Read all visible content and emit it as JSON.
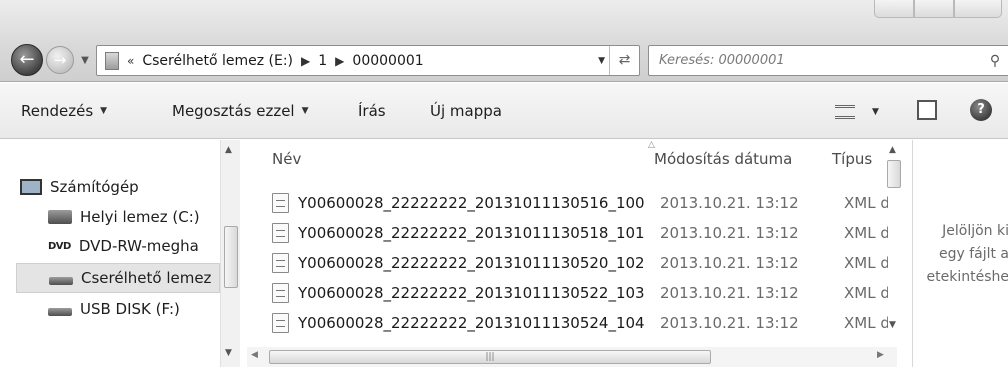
{
  "address": {
    "overflow_chevron": "«",
    "segments": [
      "Cserélhető lemez (E:)",
      "1",
      "00000001"
    ]
  },
  "search": {
    "placeholder": "Keresés: 00000001"
  },
  "toolbar": {
    "organize_label": "Rendezés",
    "share_label": "Megosztás ezzel",
    "burn_label": "Írás",
    "new_folder_label": "Új mappa",
    "help_label": "?"
  },
  "sidebar": {
    "items": [
      {
        "label": "Számítógép",
        "icon": "computer-icon"
      },
      {
        "label": "Helyi lemez (C:)",
        "icon": "hard-drive-icon"
      },
      {
        "label": "DVD-RW-megha",
        "icon": "dvd-drive-icon",
        "icon_text": "DVD"
      },
      {
        "label": "Cserélhető lemez",
        "icon": "removable-drive-icon",
        "selected": true
      },
      {
        "label": "USB DISK (F:)",
        "icon": "usb-drive-icon"
      }
    ]
  },
  "columns": {
    "name": "Név",
    "date": "Módosítás dátuma",
    "type": "Típus"
  },
  "files": [
    {
      "name": "Y00600028_22222222_20131011130516_100",
      "date": "2013.10.21. 13:12",
      "type": "XML d"
    },
    {
      "name": "Y00600028_22222222_20131011130518_101",
      "date": "2013.10.21. 13:12",
      "type": "XML d"
    },
    {
      "name": "Y00600028_22222222_20131011130520_102",
      "date": "2013.10.21. 13:12",
      "type": "XML d"
    },
    {
      "name": "Y00600028_22222222_20131011130522_103",
      "date": "2013.10.21. 13:12",
      "type": "XML d"
    },
    {
      "name": "Y00600028_22222222_20131011130524_104",
      "date": "2013.10.21. 13:12",
      "type": "XML d"
    }
  ],
  "preview": {
    "text": "Jelöljön ki\negy fájlt a\netekintéshe"
  }
}
